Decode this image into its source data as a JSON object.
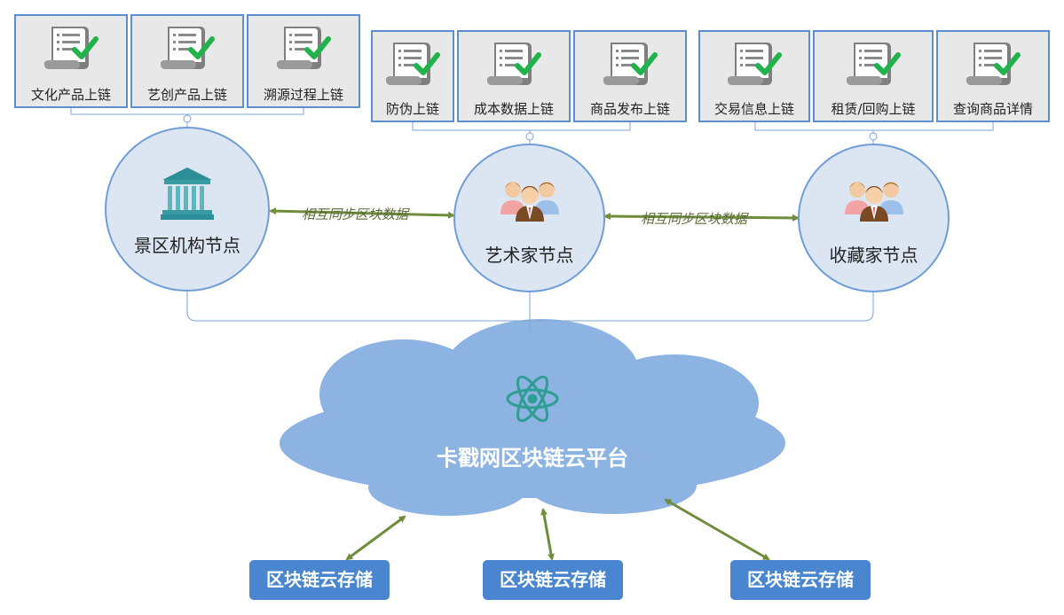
{
  "groups": [
    {
      "items": [
        {
          "label": "文化产品上链",
          "icon": "certificate-check-icon"
        },
        {
          "label": "艺创产品上链",
          "icon": "certificate-check-icon"
        },
        {
          "label": "溯源过程上链",
          "icon": "certificate-check-icon"
        }
      ]
    },
    {
      "items": [
        {
          "label": "防伪上链",
          "icon": "certificate-check-icon"
        },
        {
          "label": "成本数据上链",
          "icon": "certificate-check-icon"
        },
        {
          "label": "商品发布上链",
          "icon": "certificate-check-icon"
        }
      ]
    },
    {
      "items": [
        {
          "label": "交易信息上链",
          "icon": "certificate-check-icon"
        },
        {
          "label": "租赁/回购上链",
          "icon": "certificate-check-icon"
        },
        {
          "label": "查询商品详情",
          "icon": "certificate-check-icon"
        }
      ]
    }
  ],
  "nodes": [
    {
      "label": "景区机构节点",
      "icon": "bank-building-icon"
    },
    {
      "label": "艺术家节点",
      "icon": "people-group-icon"
    },
    {
      "label": "收藏家节点",
      "icon": "people-group-icon"
    }
  ],
  "sync_labels": [
    "相互同步区块数据",
    "相互同步区块数据"
  ],
  "platform": {
    "label": "卡戳网区块链云平台",
    "icon": "atom-icon"
  },
  "storage": [
    "区块链云存储",
    "区块链云存储",
    "区块链云存储"
  ],
  "colors": {
    "card_border": "#5d8fd0",
    "node_fill": "#dce6f3",
    "cloud": "#8db3e2",
    "storage": "#4a86cf",
    "arrow": "#6f8d3c",
    "check": "#22b24c"
  }
}
